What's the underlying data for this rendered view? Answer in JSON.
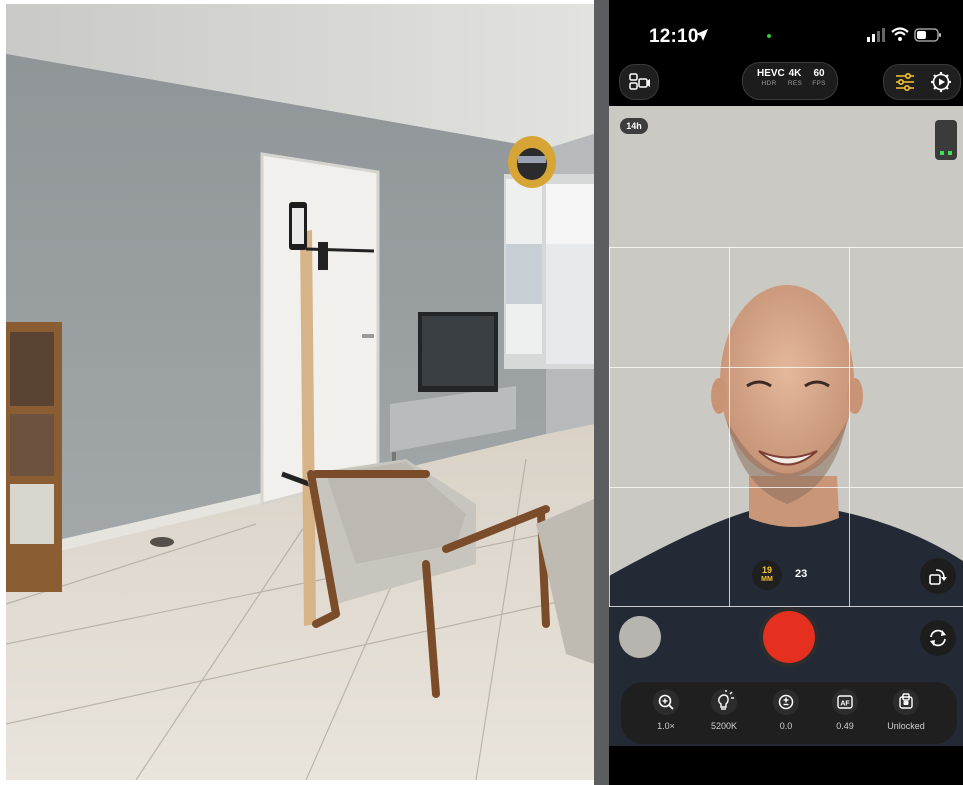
{
  "status_bar": {
    "time": "12:10"
  },
  "camera_settings": {
    "codec": "HEVC",
    "codec_sub": "HDR",
    "resolution": "4K",
    "resolution_sub": "RES",
    "fps": "60",
    "fps_sub": "FPS"
  },
  "viewfinder": {
    "storage_badge": "14h",
    "lens_mm": "19",
    "lens_unit": "MM",
    "alt_lens": "23"
  },
  "controls": [
    {
      "label": "1.0×",
      "icon": "zoom-icon"
    },
    {
      "label": "5200K",
      "icon": "white-balance-icon"
    },
    {
      "label": "0.0",
      "icon": "exposure-icon"
    },
    {
      "label": "0.49",
      "icon": "autofocus-icon"
    },
    {
      "label": "Unlocked",
      "icon": "lock-icon"
    }
  ],
  "colors": {
    "accent": "#f7c52f",
    "record": "#e5301f",
    "background": "#000000"
  }
}
